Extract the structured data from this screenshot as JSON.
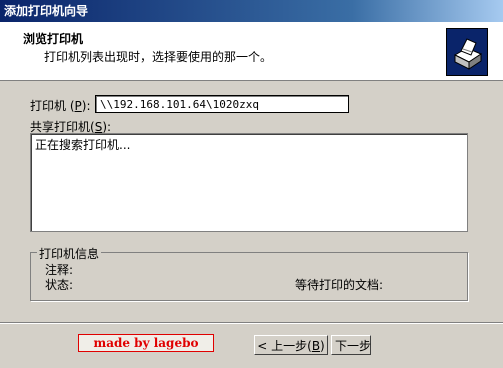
{
  "window": {
    "title": "添加打印机向导"
  },
  "header": {
    "title": "浏览打印机",
    "subtitle": "打印机列表出现时，选择要使用的那一个。",
    "icon": "printer-icon"
  },
  "printer_field": {
    "label": "打印机",
    "accel": "P",
    "value": "\\\\192.168.101.64\\1020zxq"
  },
  "shared_printers": {
    "label": "共享打印机",
    "accel": "S",
    "items": [
      "正在搜索打印机..."
    ]
  },
  "printer_info": {
    "legend": "打印机信息",
    "comment_label": "注释:",
    "status_label": "状态:",
    "pending_docs_label": "等待打印的文档:"
  },
  "watermark": {
    "text": "made by lagebo"
  },
  "buttons": {
    "back_label": "< 上一步",
    "back_accel": "B",
    "next_label": "下一步"
  }
}
